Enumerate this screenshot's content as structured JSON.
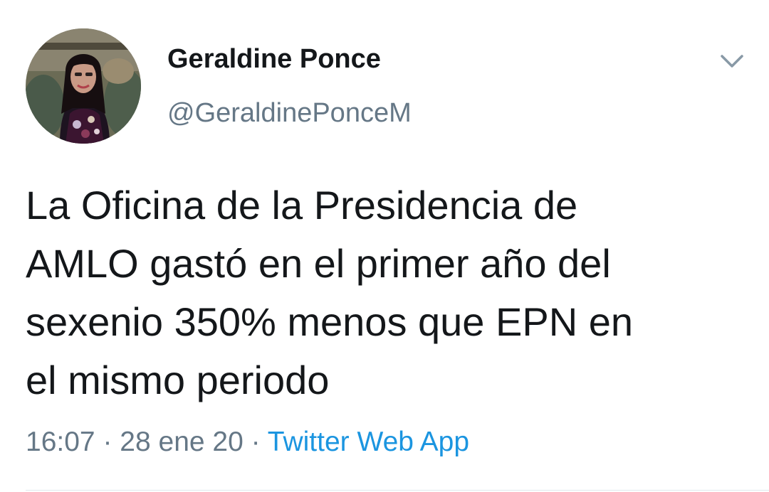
{
  "tweet": {
    "author": {
      "display_name": "Geraldine Ponce",
      "handle": "@GeraldinePonceM",
      "avatar_icon": "profile-photo"
    },
    "menu_icon": "chevron-down-icon",
    "text": "La Oficina de la Presidencia de\nAMLO gastó en el primer año del\nsexenio 350% menos que EPN en\nel mismo periodo",
    "time": "16:07",
    "date": "28 ene 20",
    "separator": "·",
    "source": "Twitter Web App",
    "colors": {
      "text": "#14171a",
      "secondary": "#657786",
      "link": "#1b95e0",
      "divider": "#e1e8ed"
    }
  }
}
